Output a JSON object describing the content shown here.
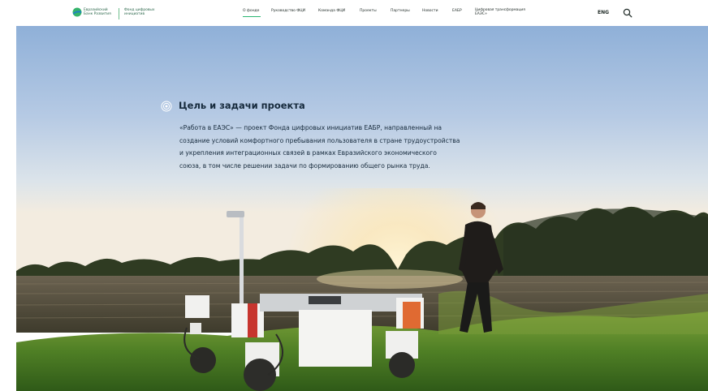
{
  "header": {
    "bank_logo_lines": [
      "Евразийский",
      "Банк Развития"
    ],
    "fund_logo_lines": [
      "Фонд цифровых",
      "инициатив"
    ],
    "nav": [
      {
        "label": "О фонде",
        "active": true
      },
      {
        "label": "Руководство ФЦИ"
      },
      {
        "label": "Команда ФЦИ"
      },
      {
        "label": "Проекты"
      },
      {
        "label": "Партнеры"
      },
      {
        "label": "Новости"
      },
      {
        "label": "ЕАБР"
      }
    ],
    "nav_digital_lines": [
      "Цифровая трансформация",
      "ЕАЭС+"
    ],
    "lang": "ENG",
    "search_icon": "search-icon",
    "accent": "#2bb673"
  },
  "hero": {
    "section_icon": "target-circle-icon",
    "title": "Цель и задачи проекта",
    "body_lines": [
      "«Работа в ЕАЭС» — проект Фонда цифровых инициатив ЕАБР, направленный на",
      "создание условий комфортного пребывания пользователя в стране трудоустройства",
      "и укрепления интеграционных связей в рамках Евразийского экономического",
      "союза, в том числе решении задачи по формированию общего рынка труда."
    ]
  }
}
